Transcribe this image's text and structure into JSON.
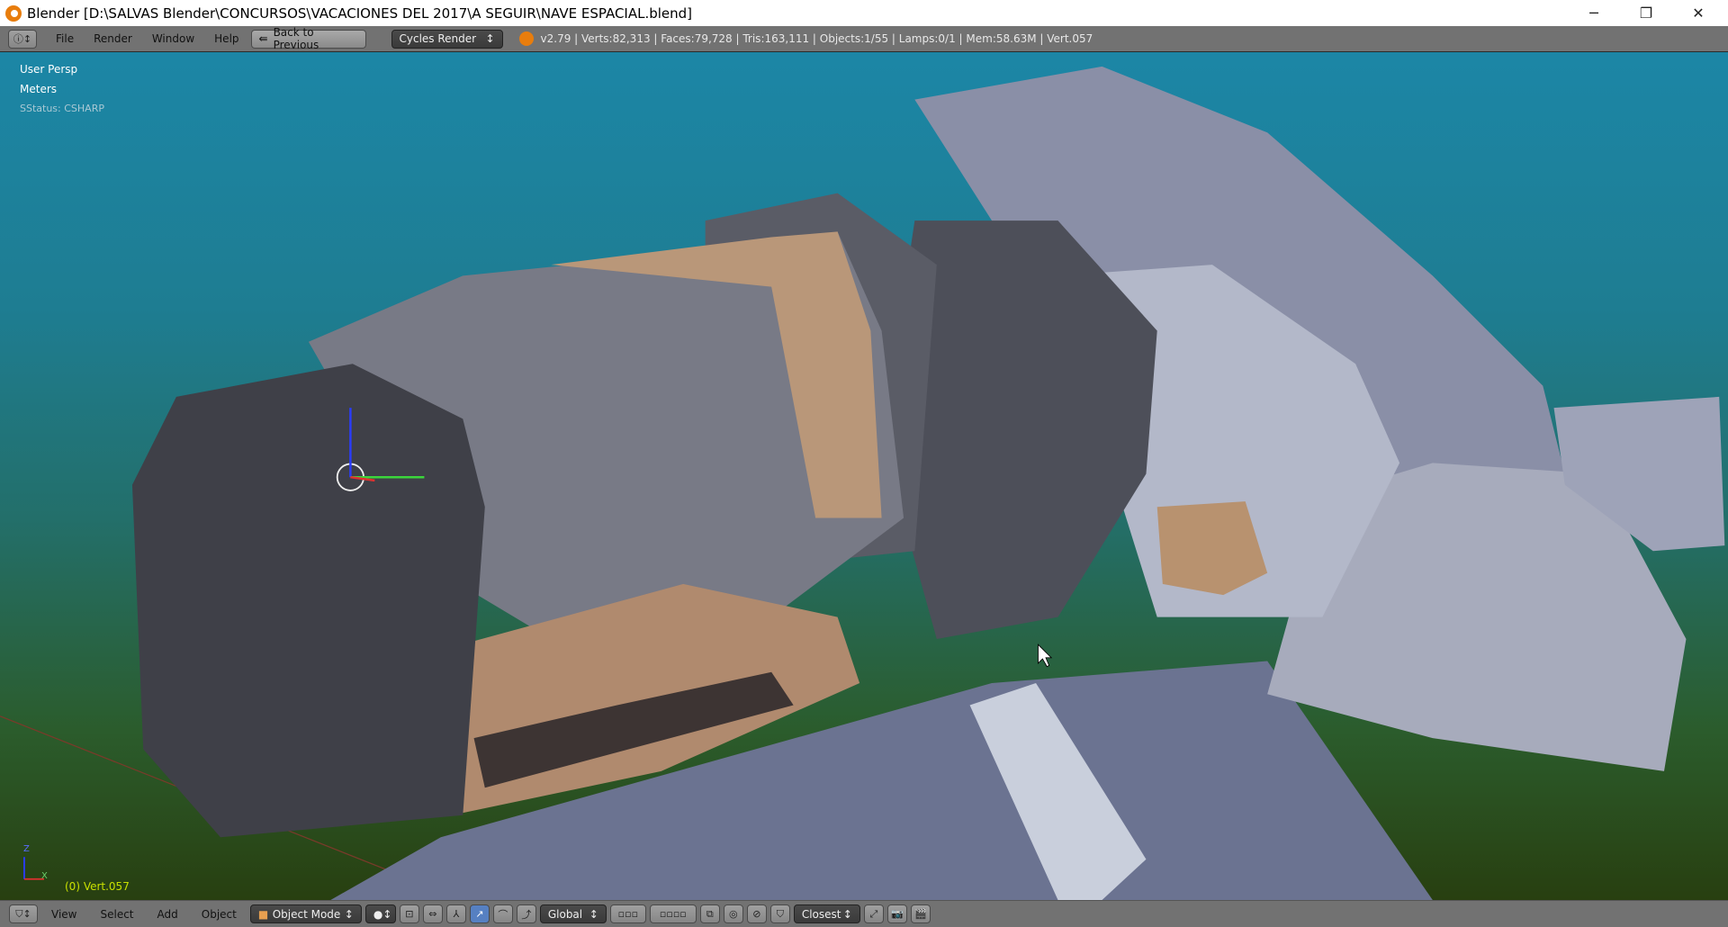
{
  "window": {
    "title": "Blender [D:\\SALVAS Blender\\CONCURSOS\\VACACIONES DEL 2017\\A SEGUIR\\NAVE ESPACIAL.blend]",
    "minimize": "─",
    "restore": "❐",
    "close": "✕"
  },
  "header": {
    "menus": [
      "File",
      "Render",
      "Window",
      "Help"
    ],
    "back_button": "Back to Previous",
    "render_engine": "Cycles Render",
    "stats": "v2.79 | Verts:82,313 | Faces:79,728 | Tris:163,111 | Objects:1/55 | Lamps:0/1 | Mem:58.63M | Vert.057"
  },
  "viewport": {
    "view_name": "User Persp",
    "units": "Meters",
    "status": "SStatus: CSHARP",
    "active_object": "(0) Vert.057",
    "axis_z": "Z",
    "axis_x": "X"
  },
  "footer": {
    "menus": [
      "View",
      "Select",
      "Add",
      "Object"
    ],
    "mode": "Object Mode",
    "orientation": "Global",
    "snap_target": "Closest"
  },
  "colors": {
    "accent": "#5680c2",
    "header_bg": "#727272",
    "object_label": "#c8e000"
  }
}
